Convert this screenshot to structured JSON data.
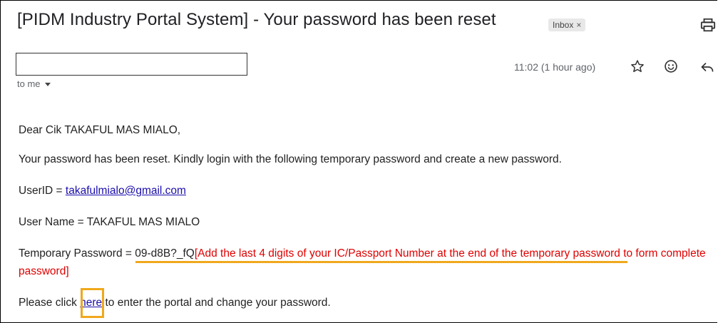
{
  "email": {
    "subject": "[PIDM Industry Portal System] - Your password has been reset",
    "label_chip": "Inbox",
    "label_chip_close": "×",
    "timestamp": "11:02 (1 hour ago)",
    "recipient_line": "to me",
    "body": {
      "greeting": "Dear Cik TAKAFUL MAS MIALO,",
      "intro": "Your password has been reset. Kindly login with the following temporary password and create a new password.",
      "userid_prefix": "UserID = ",
      "userid_email": "takafulmialo@gmail.com",
      "username_line": "User Name = TAKAFUL MAS MIALO",
      "temp_pw_prefix": "Temporary Password = ",
      "temp_pw_value": "09-d8B?_fQ",
      "temp_pw_note_line1": "[Add the last 4 digits of your IC/Passport Number at the end of the temporary password to form complete",
      "temp_pw_note_line2": "password]",
      "click_prefix": "Please click ",
      "click_link": "here",
      "click_suffix": " to enter the portal and change your password."
    }
  },
  "icons": [
    "print-icon",
    "star-icon",
    "emoji-icon",
    "reply-icon",
    "chevron-down-icon"
  ],
  "colors": {
    "link": "#1a0dab",
    "note_red": "#e00000",
    "highlight_orange": "#f0a81c"
  }
}
